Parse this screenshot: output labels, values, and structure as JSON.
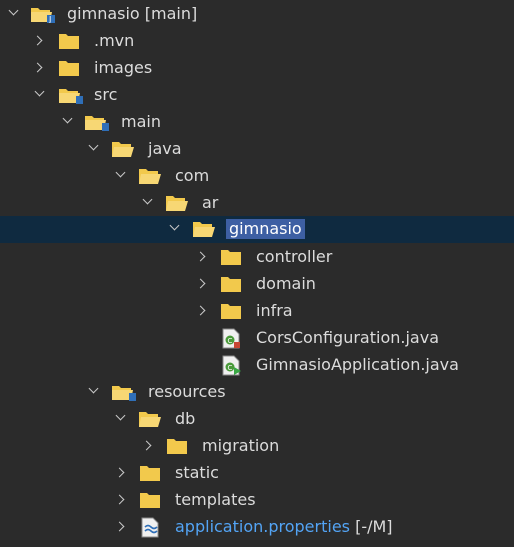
{
  "tree": {
    "rows": [
      {
        "label": "gimnasio",
        "suffix": " [main]",
        "state": "expanded",
        "icon": "project-folder-icon",
        "link": false
      },
      {
        "label": ".mvn",
        "state": "collapsed",
        "icon": "folder-icon"
      },
      {
        "label": "images",
        "state": "collapsed",
        "icon": "folder-icon"
      },
      {
        "label": "src",
        "state": "expanded",
        "icon": "source-folder-icon"
      },
      {
        "label": "main",
        "state": "expanded",
        "icon": "source-folder-icon"
      },
      {
        "label": "java",
        "state": "expanded",
        "icon": "folder-open-icon"
      },
      {
        "label": "com",
        "state": "expanded",
        "icon": "folder-open-icon"
      },
      {
        "label": "ar",
        "state": "expanded",
        "icon": "folder-open-icon"
      },
      {
        "label": "gimnasio",
        "state": "expanded",
        "icon": "folder-open-icon",
        "selected": true
      },
      {
        "label": "controller",
        "state": "collapsed",
        "icon": "folder-icon"
      },
      {
        "label": "domain",
        "state": "collapsed",
        "icon": "folder-icon"
      },
      {
        "label": "infra",
        "state": "collapsed",
        "icon": "folder-icon"
      },
      {
        "label": "CorsConfiguration.java",
        "state": "none",
        "icon": "java-class-icon"
      },
      {
        "label": "GimnasioApplication.java",
        "state": "none",
        "icon": "java-main-class-icon"
      },
      {
        "label": "resources",
        "state": "expanded",
        "icon": "resource-folder-icon"
      },
      {
        "label": "db",
        "state": "expanded",
        "icon": "folder-open-icon"
      },
      {
        "label": "migration",
        "state": "collapsed",
        "icon": "folder-icon"
      },
      {
        "label": "static",
        "state": "collapsed",
        "icon": "folder-icon"
      },
      {
        "label": "templates",
        "state": "collapsed",
        "icon": "folder-icon"
      },
      {
        "label": "application.properties",
        "suffix": " [-/M]",
        "state": "collapsed",
        "icon": "properties-file-icon",
        "link": true
      }
    ]
  },
  "colors": {
    "background": "#2b2b2b",
    "selection_row": "#0f2a40",
    "selection_text": "#3d5fa3",
    "folder": "#f2c94c",
    "link": "#53a4f5"
  }
}
